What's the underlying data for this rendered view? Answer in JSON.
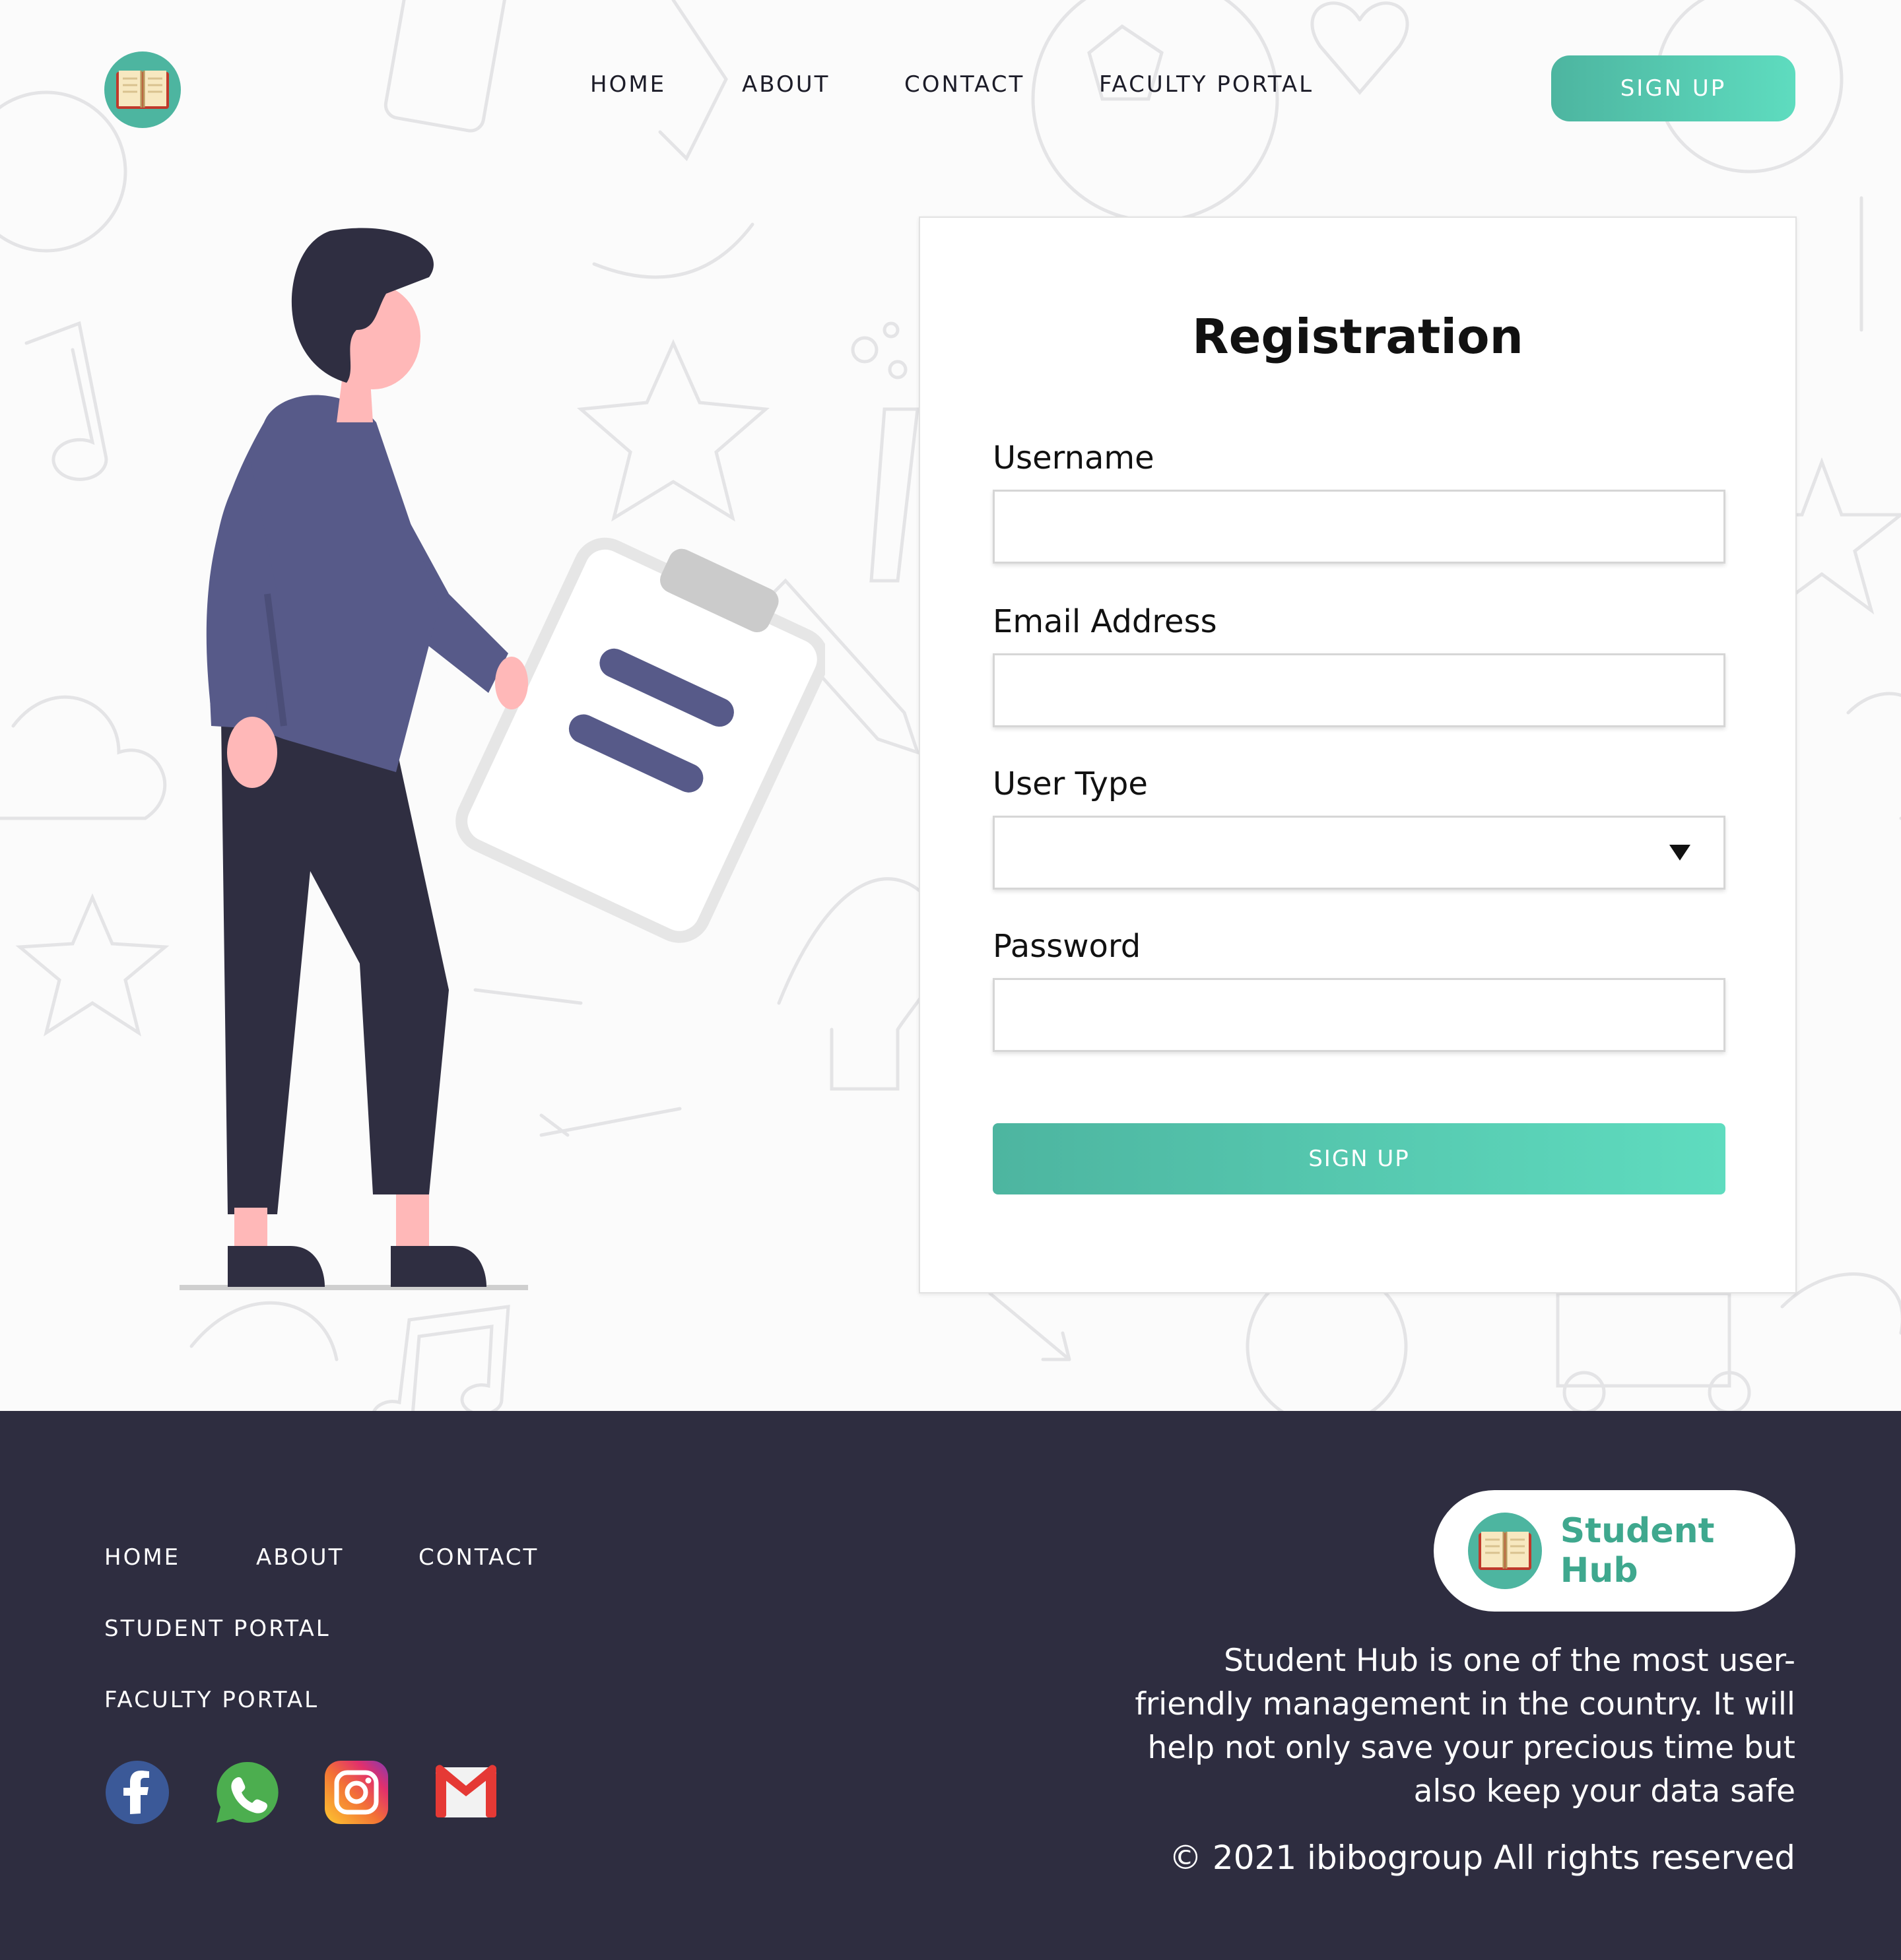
{
  "header": {
    "logo_icon": "open-book-icon",
    "nav": [
      "HOME",
      "ABOUT",
      "CONTACT",
      "FACULTY PORTAL"
    ],
    "signup_label": "SIGN UP"
  },
  "form": {
    "title": "Registration",
    "username_label": "Username",
    "username_value": "",
    "email_label": "Email Address",
    "email_value": "",
    "usertype_label": "User Type",
    "usertype_selected": "",
    "password_label": "Password",
    "password_value": "",
    "submit_label": "SIGN UP"
  },
  "footer": {
    "links": [
      "HOME",
      "ABOUT",
      "CONTACT",
      "STUDENT PORTAL",
      "FACULTY PORTAL"
    ],
    "social": [
      "facebook-icon",
      "whatsapp-icon",
      "instagram-icon",
      "gmail-icon"
    ],
    "brand_name": "Student Hub",
    "about": "Student Hub is one of the most user-friendly management in the country. It will help not only save your precious time but also keep your data safe",
    "copyright": "© 2021 ibibogroup All rights reserved"
  },
  "colors": {
    "accent": "#4db5a0",
    "accent_light": "#5edcbf",
    "footer_bg": "#2e2d40",
    "figure_shirt": "#575a89",
    "figure_pants": "#2f2e41",
    "skin": "#ffb8b8"
  }
}
